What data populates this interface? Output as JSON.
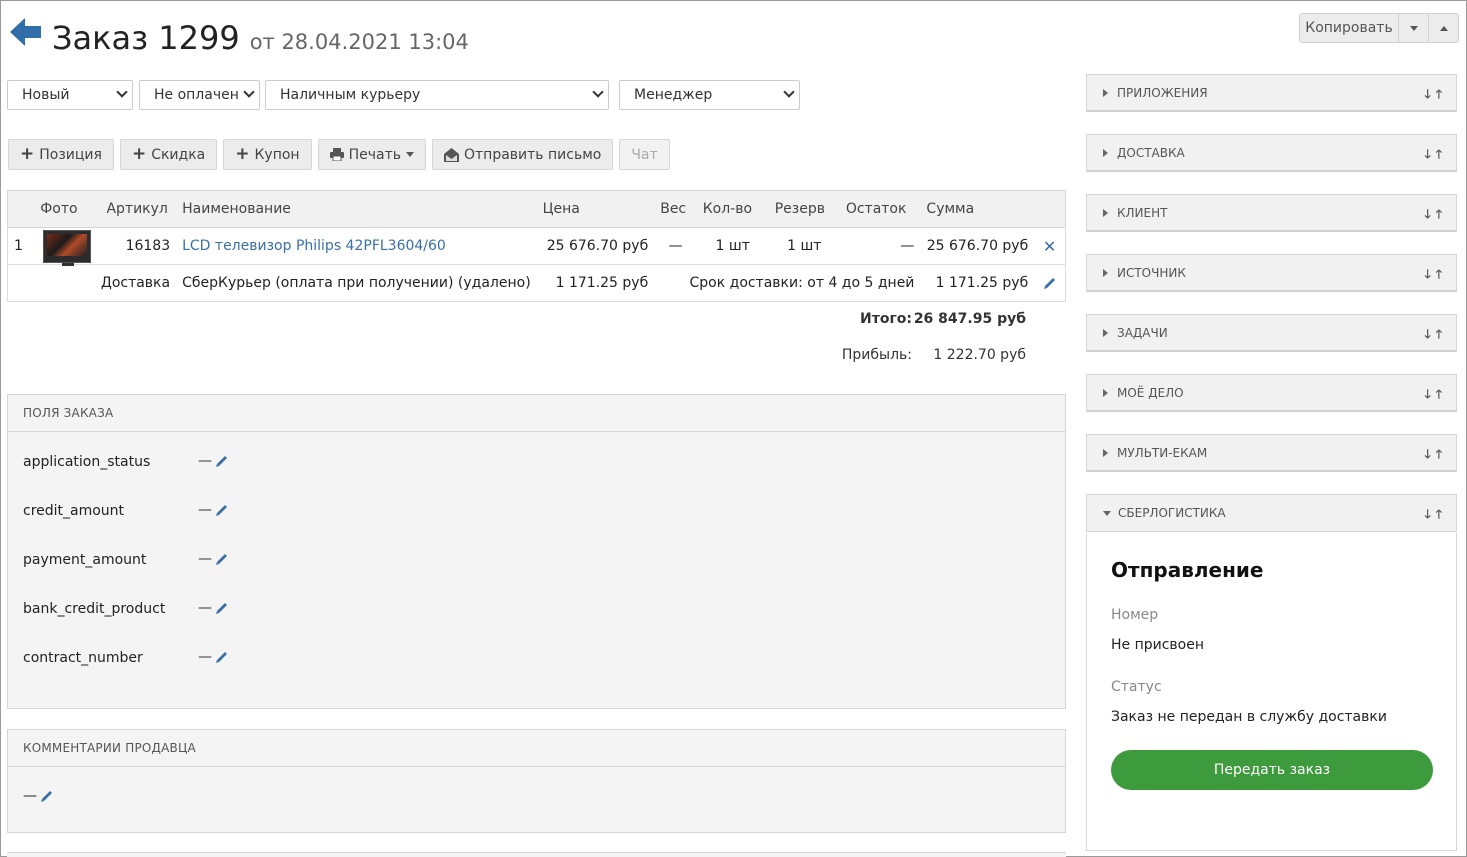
{
  "header": {
    "title": "Заказ 1299",
    "subtitle": "от 28.04.2021 13:04",
    "copy_label": "Копировать"
  },
  "selects": {
    "status": "Новый",
    "payment": "Не оплачен",
    "delivery": "Наличным курьеру",
    "manager": "Менеджер"
  },
  "actions": {
    "position": "Позиция",
    "discount": "Скидка",
    "coupon": "Купон",
    "print": "Печать",
    "send_mail": "Отправить письмо",
    "chat": "Чат"
  },
  "table": {
    "headers": {
      "photo": "Фото",
      "sku": "Артикул",
      "name": "Наименование",
      "price": "Цена",
      "weight": "Вес",
      "qty": "Кол-во",
      "reserve": "Резерв",
      "stock": "Остаток",
      "sum": "Сумма"
    },
    "items": [
      {
        "num": "1",
        "sku": "16183",
        "name": "LCD телевизор Philips 42PFL3604/60",
        "price": "25 676.70 руб",
        "weight": "—",
        "qty": "1 шт",
        "reserve": "1 шт",
        "stock": "—",
        "sum": "25 676.70 руб"
      }
    ],
    "delivery": {
      "label": "Доставка",
      "name": "СберКурьер (оплата при получении) (удалено)",
      "price": "1 171.25 руб",
      "term": "Срок доставки: от 4 до 5 дней",
      "sum": "1 171.25 руб"
    }
  },
  "totals": {
    "total_label": "Итого:",
    "total_value": "26 847.95 руб",
    "profit_label": "Прибыль:",
    "profit_value": "1 222.70 руб"
  },
  "order_fields": {
    "title": "ПОЛЯ ЗАКАЗА",
    "fields": [
      {
        "name": "application_status",
        "value": "—"
      },
      {
        "name": "credit_amount",
        "value": "—"
      },
      {
        "name": "payment_amount",
        "value": "—"
      },
      {
        "name": "bank_credit_product",
        "value": "—"
      },
      {
        "name": "contract_number",
        "value": "—"
      }
    ]
  },
  "seller_comments": {
    "title": "КОММЕНТАРИИ ПРОДАВЦА",
    "value": "—"
  },
  "sidebar": {
    "panels": [
      "ПРИЛОЖЕНИЯ",
      "ДОСТАВКА",
      "КЛИЕНТ",
      "ИСТОЧНИК",
      "ЗАДАЧИ",
      "МОЁ ДЕЛО",
      "МУЛЬТИ-ЕКАМ",
      "СБЕРЛОГИСТИКА"
    ],
    "sberlogistics": {
      "heading": "Отправление",
      "number_label": "Номер",
      "number_value": "Не присвоен",
      "status_label": "Статус",
      "status_value": "Заказ не передан в службу доставки",
      "submit_label": "Передать заказ"
    }
  },
  "colors": {
    "accent": "#3a6fa5",
    "green": "#3d9a3d",
    "back_arrow": "#2f6ea8"
  }
}
